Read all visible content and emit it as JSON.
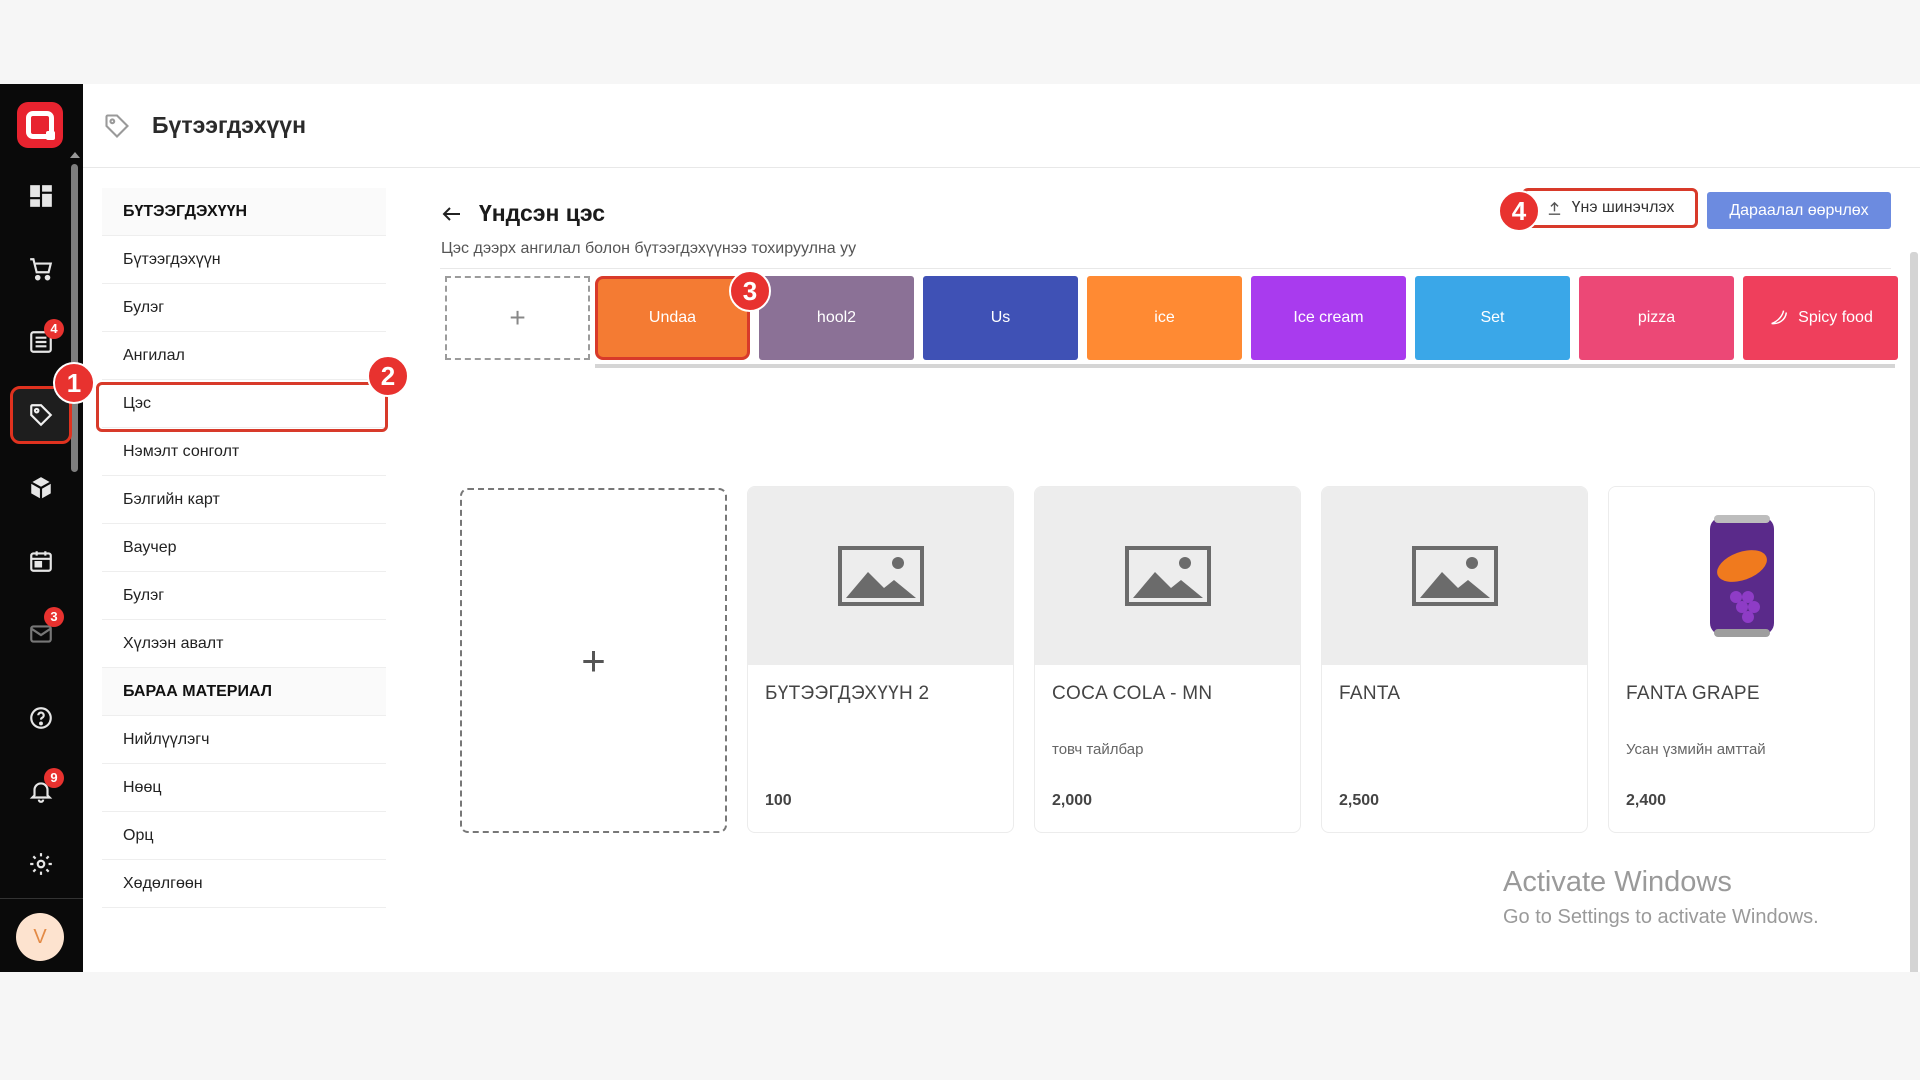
{
  "header": {
    "title": "Бүтээгдэхүүн"
  },
  "rail": {
    "order_badge": "4",
    "mail_badge": "3",
    "notif_badge": "9",
    "avatar_letter": "V"
  },
  "nav": {
    "section1": "БҮТЭЭГДЭХҮҮН",
    "items1": [
      "Бүтээгдэхүүн",
      "Булэг",
      "Ангилал",
      "Цэс",
      "Нэмэлт сонголт",
      "Бэлгийн карт",
      "Ваучер",
      "Булэг",
      "Хүлээн авалт"
    ],
    "section2": "БАРАА МАТЕРИАЛ",
    "items2": [
      "Нийлүүлэгч",
      "Нөөц",
      "Орц",
      "Хөдөлгөөн"
    ]
  },
  "page": {
    "title": "Үндсэн цэс",
    "subtitle": "Цэс дээрх ангилал болон бүтээгдэхүүнээ тохируулна уу",
    "btn_price": "Үнэ шинэчлэх",
    "btn_order": "Дараалал өөрчлөх"
  },
  "tabs": [
    {
      "label": "Undaa",
      "color": "#f47b33"
    },
    {
      "label": "hool2",
      "color": "#8b7196"
    },
    {
      "label": "Us",
      "color": "#3f51b5"
    },
    {
      "label": "ice",
      "color": "#ff8a33"
    },
    {
      "label": "Ice cream",
      "color": "#a93bee"
    },
    {
      "label": "Set",
      "color": "#3aa7e8"
    },
    {
      "label": "pizza",
      "color": "#ec4876"
    },
    {
      "label": "Spicy food",
      "color": "#ef3f5c"
    }
  ],
  "products": [
    {
      "name": "БҮТЭЭГДЭХҮҮН 2",
      "desc": "",
      "price": "100"
    },
    {
      "name": "COCA COLA - MN",
      "desc": "товч тайлбар",
      "price": "2,000"
    },
    {
      "name": "FANTA",
      "desc": "",
      "price": "2,500"
    },
    {
      "name": "FANTA GRAPE",
      "desc": "Усан үзмийн амттай",
      "price": "2,400"
    }
  ],
  "markers": [
    "1",
    "2",
    "3",
    "4"
  ],
  "watermark": {
    "line1": "Activate Windows",
    "line2": "Go to Settings to activate Windows."
  }
}
